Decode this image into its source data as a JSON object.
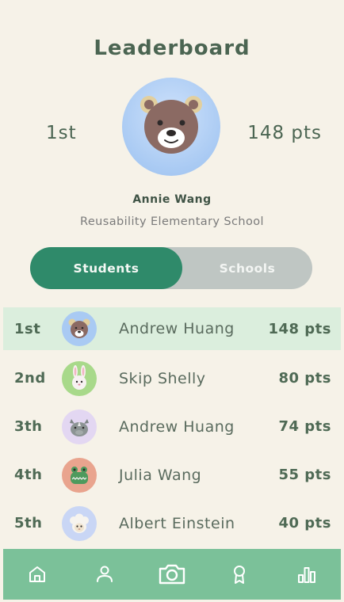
{
  "header": {
    "title": "Leaderboard"
  },
  "profile": {
    "rank": "1st",
    "points": "148 pts",
    "name": "Annie Wang",
    "school": "Reusability Elementary School",
    "avatar": "bear-icon"
  },
  "toggle": {
    "students_label": "Students",
    "schools_label": "Schools",
    "selected": "Students"
  },
  "leaderboard": [
    {
      "rank": "1st",
      "name": "Andrew Huang",
      "points": "148 pts",
      "avatar": "bear-icon",
      "avatar_bg": "#a9caf3",
      "highlighted": true
    },
    {
      "rank": "2nd",
      "name": "Skip Shelly",
      "points": "80 pts",
      "avatar": "bunny-icon",
      "avatar_bg": "#a8d98a"
    },
    {
      "rank": "3th",
      "name": "Andrew Huang",
      "points": "74 pts",
      "avatar": "rhino-icon",
      "avatar_bg": "#e3d7f2"
    },
    {
      "rank": "4th",
      "name": "Julia Wang",
      "points": "55 pts",
      "avatar": "crocodile-icon",
      "avatar_bg": "#e9a48e"
    },
    {
      "rank": "5th",
      "name": "Albert Einstein",
      "points": "40 pts",
      "avatar": "sheep-icon",
      "avatar_bg": "#c9d6f5"
    }
  ],
  "nav": [
    {
      "icon": "home-icon"
    },
    {
      "icon": "profile-icon"
    },
    {
      "icon": "camera-icon"
    },
    {
      "icon": "award-icon"
    },
    {
      "icon": "chart-icon"
    }
  ],
  "colors": {
    "accent": "#2f8a6a",
    "navbar": "#7bc199",
    "highlight_row": "#dbeedd",
    "background": "#f6f2e8"
  }
}
